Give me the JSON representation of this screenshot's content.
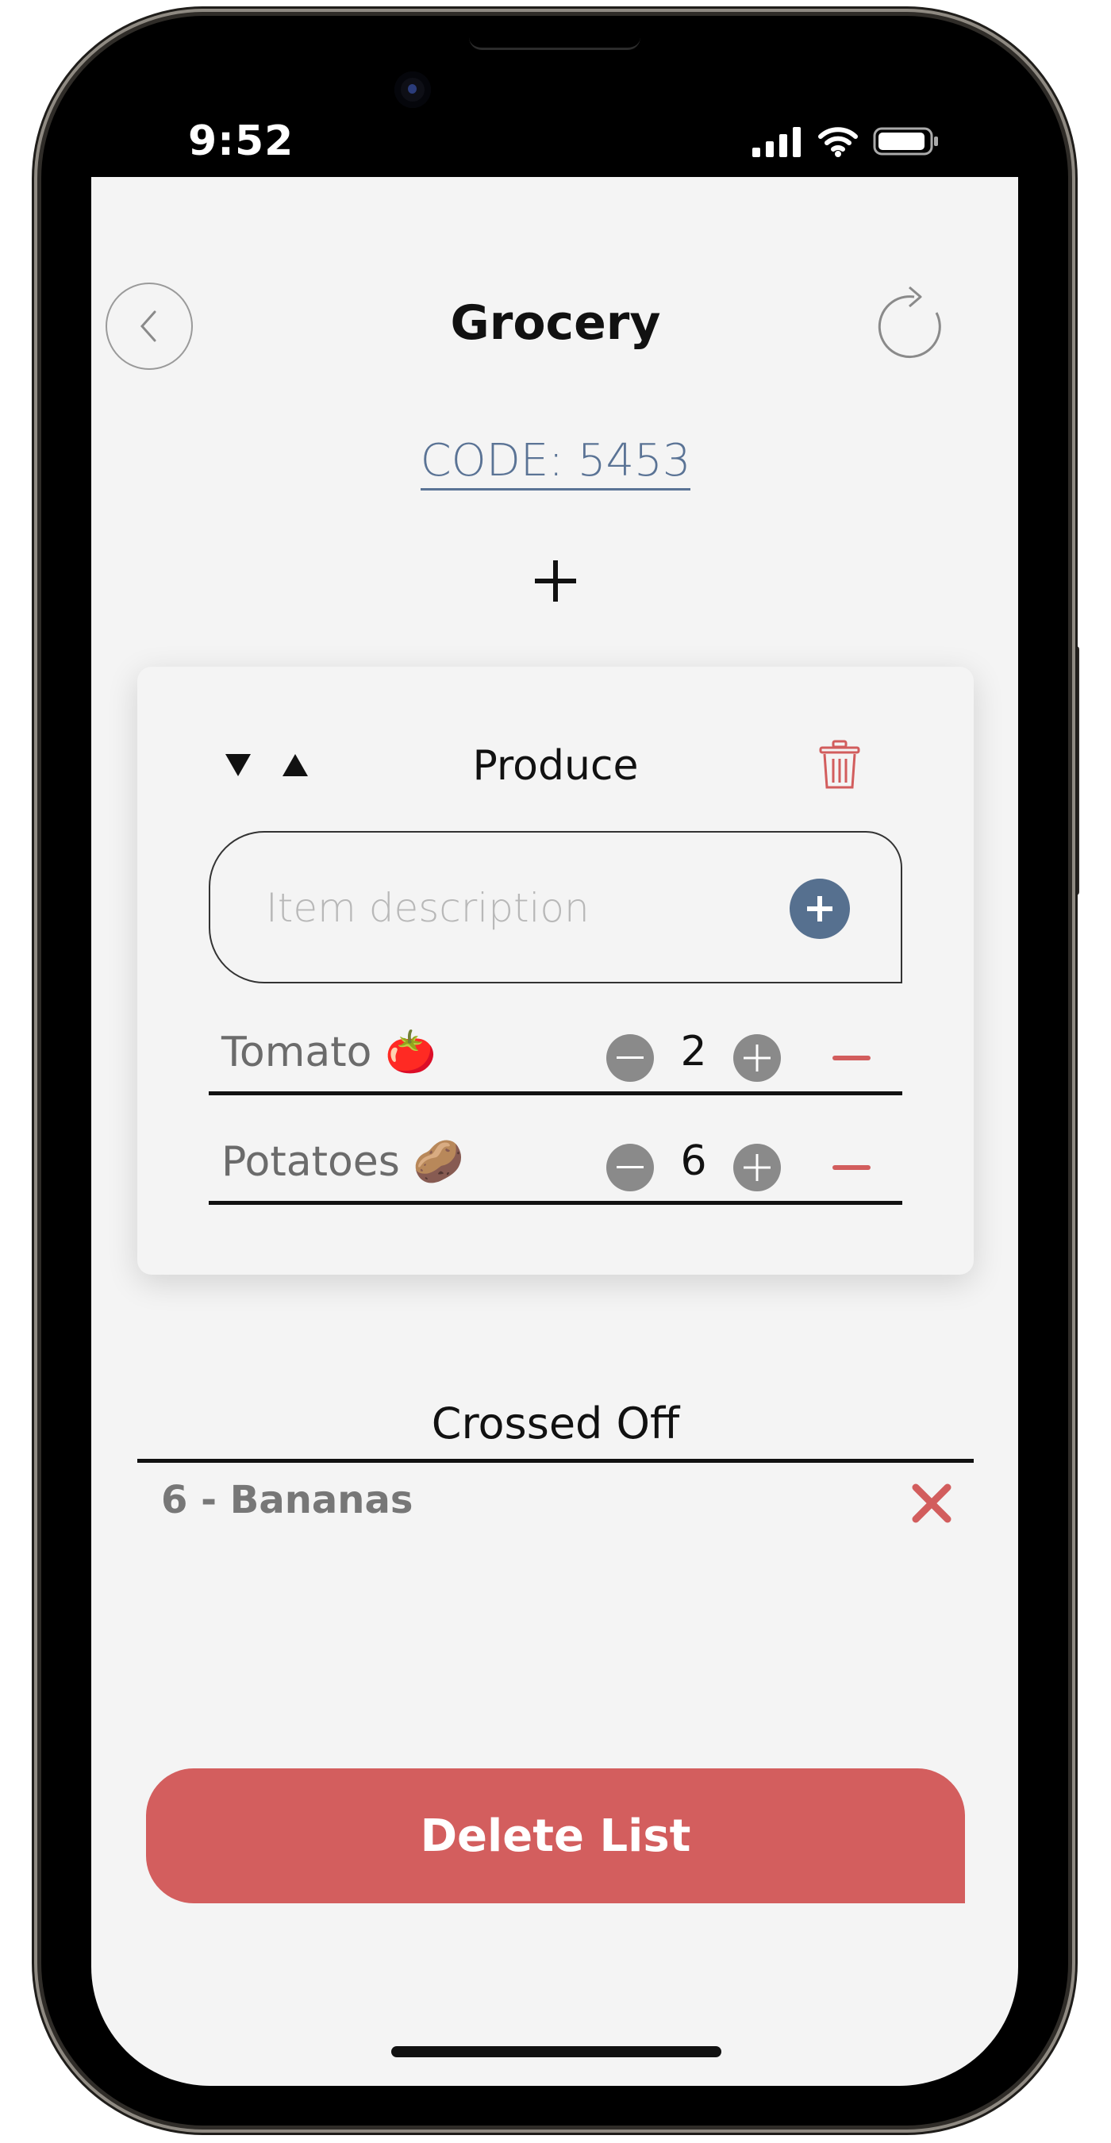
{
  "status_bar": {
    "time": "9:52"
  },
  "header": {
    "title": "Grocery",
    "code": "CODE: 5453"
  },
  "category": {
    "title": "Produce",
    "input_placeholder": "Item description",
    "items": [
      {
        "name": "Tomato 🍅",
        "quantity": "2"
      },
      {
        "name": "Potatoes 🥔",
        "quantity": "6"
      }
    ]
  },
  "crossed_off": {
    "title": "Crossed Off",
    "items": [
      {
        "label": "6 - Bananas"
      }
    ]
  },
  "actions": {
    "delete_list_label": "Delete List"
  },
  "colors": {
    "accent_blue": "#56708f",
    "danger_red": "#d35e5e",
    "background": "#f4f4f4"
  },
  "icons": {
    "back": "chevron-left-icon",
    "refresh": "refresh-icon",
    "add": "plus-icon",
    "trash": "trash-icon",
    "remove_crossed": "close-icon"
  }
}
